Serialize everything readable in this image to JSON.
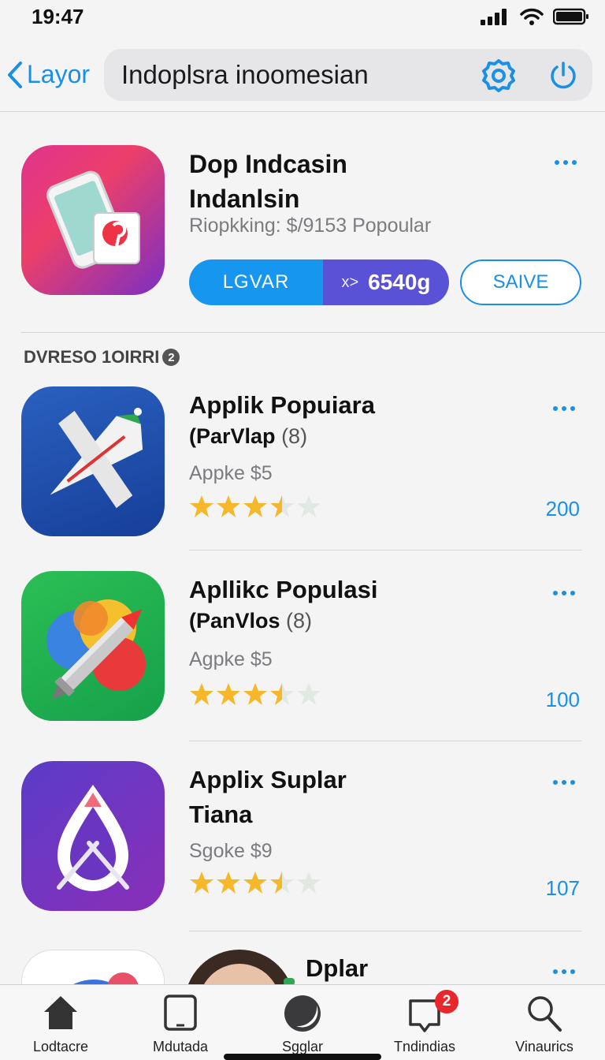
{
  "status_bar": {
    "time": "19:47"
  },
  "nav": {
    "back_label": "Layor",
    "search_text": "Indoplsra inoomesian"
  },
  "featured": {
    "title_line1": "Dop Indcasin",
    "title_line2": "Indanlsin",
    "subtitle": "Riopkking: $/9153 Popoular",
    "get_label": "LGVAR",
    "get_multiplier": "x>",
    "get_value": "6540g",
    "save_label": "SAIVE"
  },
  "section": {
    "title": "DVRESO 1OIRRI",
    "badge": "2"
  },
  "list": [
    {
      "title": "Applik Popuiara",
      "subtitle_name": "(ParVlap",
      "subtitle_count": "(8)",
      "price": "Appke $5",
      "rating": 3.5,
      "count": "200"
    },
    {
      "title": "Apllikc Populasi",
      "subtitle_name": "(PanVlos",
      "subtitle_count": "(8)",
      "price": "Agpke $5",
      "rating": 3.5,
      "count": "100"
    },
    {
      "title": "Applix Suplar",
      "subtitle_bold": "Tiana",
      "price": "Sgoke $9",
      "rating": 3.5,
      "count": "107"
    }
  ],
  "partial_item": {
    "title": "Dplar"
  },
  "tabs": [
    {
      "label": "Lodtacre",
      "icon": "home-icon"
    },
    {
      "label": "Mdutada",
      "icon": "tablet-icon"
    },
    {
      "label": "Sgglar",
      "icon": "moon-icon"
    },
    {
      "label": "Tndindias",
      "icon": "inbox-icon",
      "badge": "2"
    },
    {
      "label": "Vinaurics",
      "icon": "search-icon"
    }
  ],
  "colors": {
    "accent": "#1a8fe8",
    "badge_red": "#e8262b",
    "star": "#f4b82a"
  }
}
